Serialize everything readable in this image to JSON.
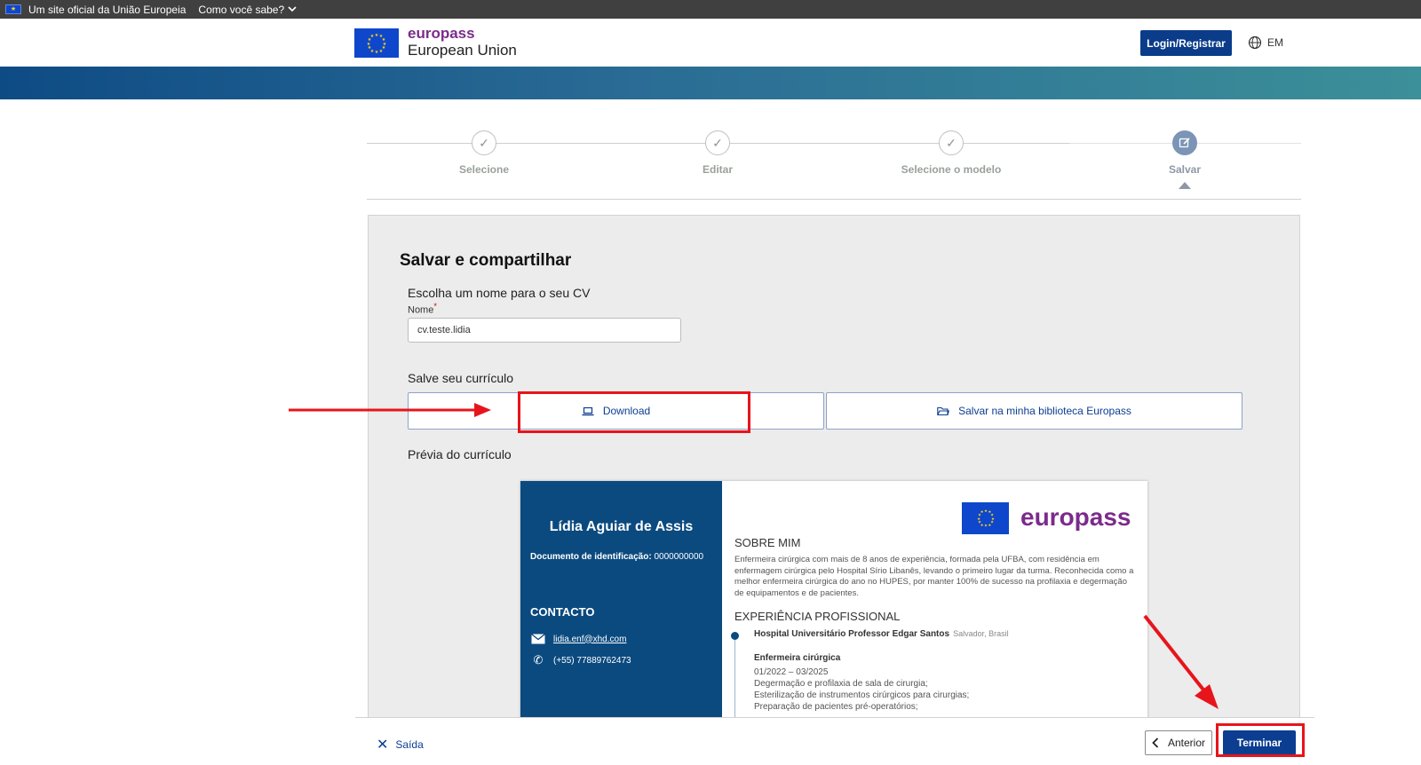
{
  "topbar": {
    "official": "Um site oficial da União Europeia",
    "how_know": "Como você sabe?"
  },
  "header": {
    "brand": "europass",
    "org": "European Union",
    "login": "Login/Registrar",
    "lang": "EM"
  },
  "stepper": {
    "steps": [
      {
        "label": "Selecione",
        "state": "done"
      },
      {
        "label": "Editar",
        "state": "done"
      },
      {
        "label": "Selecione o modelo",
        "state": "done"
      },
      {
        "label": "Salvar",
        "state": "active"
      }
    ]
  },
  "panel": {
    "title": "Salvar e compartilhar",
    "choose_name": "Escolha um nome para o seu CV",
    "name_label": "Nome",
    "name_value": "cv.teste.lidia",
    "save_label": "Salve seu currículo",
    "download": "Download",
    "save_library": "Salvar na minha biblioteca Europass",
    "preview_label": "Prévia do currículo"
  },
  "cv": {
    "name": "Lídia Aguiar de Assis",
    "doc_label": "Documento de identificação:",
    "doc_value": "0000000000",
    "contact_title": "CONTACTO",
    "email": "lidia.enf@xhd.com",
    "phone": "(+55) 77889762473",
    "brand": "europass",
    "about_title": "SOBRE MIM",
    "about_text": "Enfermeira cirúrgica com mais de 8 anos de experiência, formada pela UFBA, com residência em enfermagem cirúrgica pelo Hospital Sírio Libanês, levando o primeiro lugar da turma. Reconhecida como a melhor enfermeira cirúrgica do ano no HUPES, por manter 100% de sucesso na profilaxia e degermação de equipamentos e de pacientes.",
    "exp_title": "EXPERIÊNCIA PROFISSIONAL",
    "employer": "Hospital Universitário Professor Edgar Santos",
    "location": "Salvador, Brasil",
    "role": "Enfermeira cirúrgica",
    "dates": "01/2022 – 03/2025",
    "duty1": "Degermação e profilaxia de sala de cirurgia;",
    "duty2": "Esterilização de instrumentos cirúrgicos para cirurgias;",
    "duty3": "Preparação de pacientes pré-operatórios;"
  },
  "footer": {
    "exit": "Saída",
    "previous": "Anterior",
    "finish": "Terminar"
  },
  "colors": {
    "primary": "#0b3d91",
    "brand_purple": "#7b2b8b",
    "cv_sidebar": "#0b4a7f",
    "highlight": "#e8141b"
  },
  "icons": [
    "eu-flag-icon",
    "chevron-down-icon",
    "globe-icon",
    "check-icon",
    "edit-icon",
    "laptop-icon",
    "folder-icon",
    "mail-icon",
    "phone-icon",
    "close-icon",
    "chevron-left-icon"
  ]
}
